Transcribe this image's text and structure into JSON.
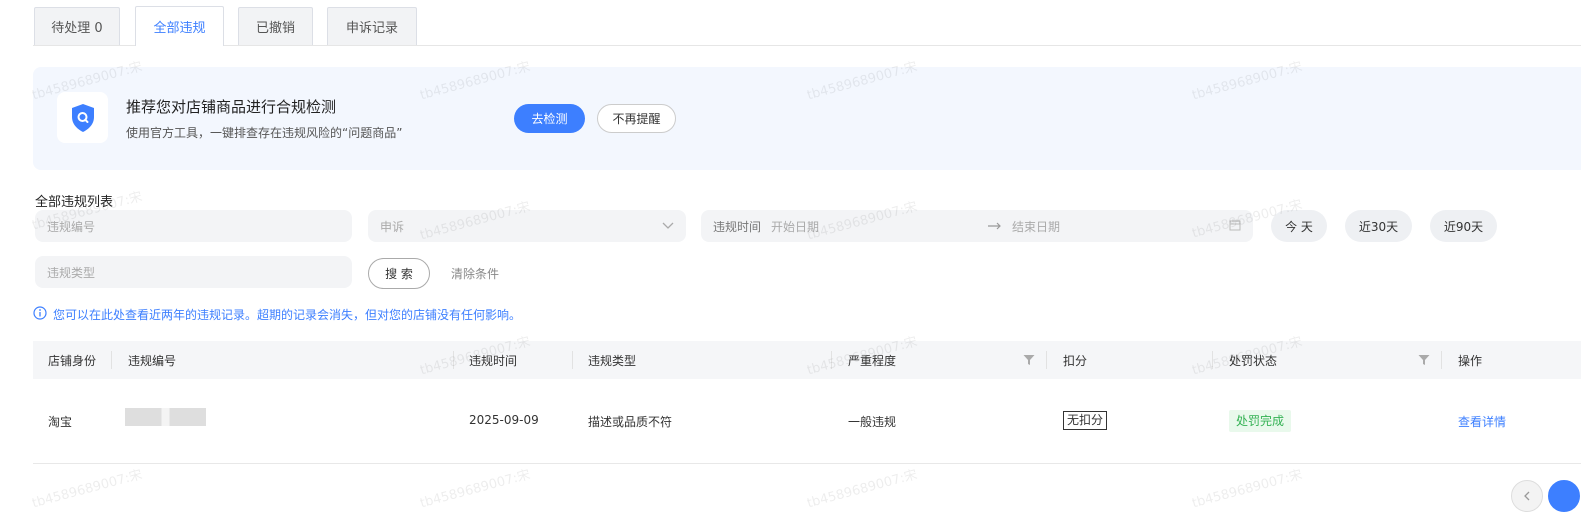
{
  "tabs": [
    {
      "label": "待处理 0"
    },
    {
      "label": "全部违规"
    },
    {
      "label": "已撤销"
    },
    {
      "label": "申诉记录"
    }
  ],
  "banner": {
    "title": "推荐您对店铺商品进行合规检测",
    "desc": "使用官方工具，一键排查存在违规风险的“问题商品”",
    "check_label": "去检测",
    "dismiss_label": "不再提醒"
  },
  "filters": {
    "section_title": "全部违规列表",
    "violation_no_placeholder": "违规编号",
    "appeal_label": "申诉",
    "time_label": "违规时间",
    "start_placeholder": "开始日期",
    "end_placeholder": "结束日期",
    "today_label": "今 天",
    "last30_label": "近30天",
    "last90_label": "近90天",
    "type_placeholder": "违规类型",
    "search_label": "搜 索",
    "clear_label": "清除条件"
  },
  "notice": "您可以在此处查看近两年的违规记录。超期的记录会消失，但对您的店铺没有任何影响。",
  "table": {
    "columns": [
      "店铺身份",
      "违规编号",
      "违规时间",
      "违规类型",
      "严重程度",
      "扣分",
      "处罚状态",
      "操作"
    ],
    "rows": [
      {
        "shop": "淘宝",
        "time": "2025-09-09",
        "type": "描述或品质不符",
        "severity": "一般违规",
        "deduct": "无扣分",
        "status": "处罚完成",
        "action": "查看详情"
      }
    ]
  },
  "watermark": "tb4589689007:宋",
  "colors": {
    "accent": "#3d7fff",
    "status_green": "#34b254",
    "banner_bg": "#f3f7fe"
  }
}
